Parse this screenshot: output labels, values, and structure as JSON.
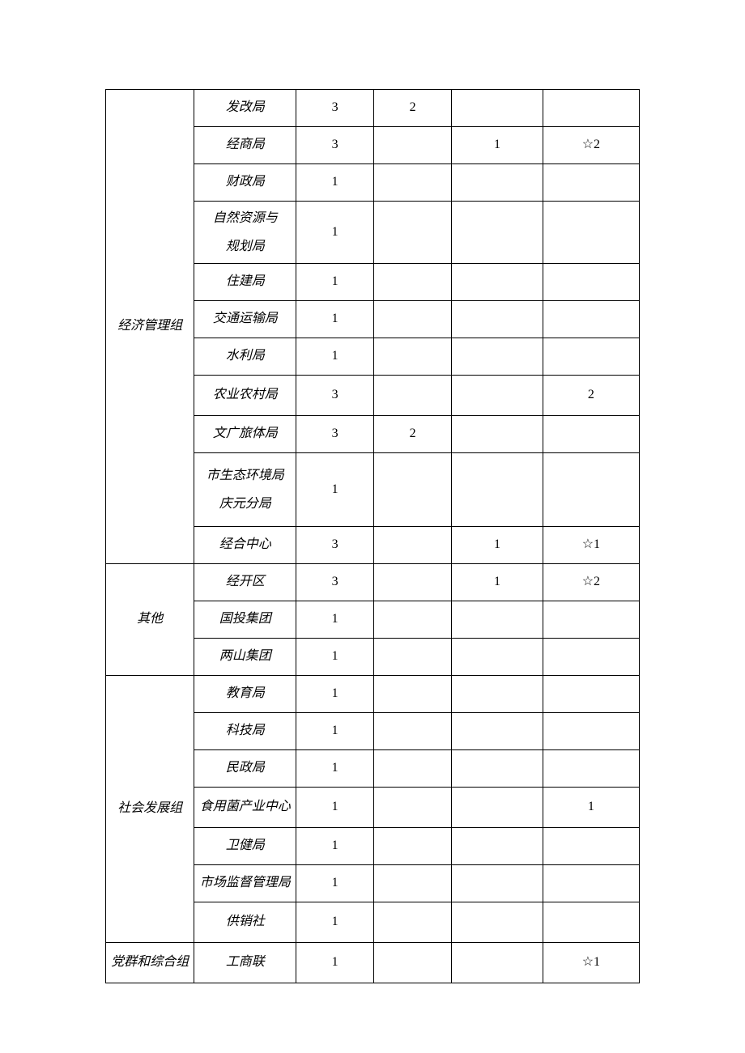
{
  "groups": {
    "g1": "经济管理组",
    "g2": "其他",
    "g3": "社会发展组",
    "g4": "党群和综合组"
  },
  "rows": {
    "r1": {
      "dept": "发改局",
      "c3": "3",
      "c4": "2",
      "c5": "",
      "c6": ""
    },
    "r2": {
      "dept": "经商局",
      "c3": "3",
      "c4": "",
      "c5": "1",
      "c6": "☆2"
    },
    "r3": {
      "dept": "财政局",
      "c3": "1",
      "c4": "",
      "c5": "",
      "c6": ""
    },
    "r4": {
      "dept": "自然资源与\n规划局",
      "c3": "1",
      "c4": "",
      "c5": "",
      "c6": ""
    },
    "r5": {
      "dept": "住建局",
      "c3": "1",
      "c4": "",
      "c5": "",
      "c6": ""
    },
    "r6": {
      "dept": "交通运输局",
      "c3": "1",
      "c4": "",
      "c5": "",
      "c6": ""
    },
    "r7": {
      "dept": "水利局",
      "c3": "1",
      "c4": "",
      "c5": "",
      "c6": ""
    },
    "r8": {
      "dept": "农业农村局",
      "c3": "3",
      "c4": "",
      "c5": "",
      "c6": "2"
    },
    "r9": {
      "dept": "文广旅体局",
      "c3": "3",
      "c4": "2",
      "c5": "",
      "c6": ""
    },
    "r10": {
      "dept": "市生态环境局\n庆元分局",
      "c3": "1",
      "c4": "",
      "c5": "",
      "c6": ""
    },
    "r11": {
      "dept": "经合中心",
      "c3": "3",
      "c4": "",
      "c5": "1",
      "c6": "☆1"
    },
    "r12": {
      "dept": "经开区",
      "c3": "3",
      "c4": "",
      "c5": "1",
      "c6": "☆2"
    },
    "r13": {
      "dept": "国投集团",
      "c3": "1",
      "c4": "",
      "c5": "",
      "c6": ""
    },
    "r14": {
      "dept": "两山集团",
      "c3": "1",
      "c4": "",
      "c5": "",
      "c6": ""
    },
    "r15": {
      "dept": "教育局",
      "c3": "1",
      "c4": "",
      "c5": "",
      "c6": ""
    },
    "r16": {
      "dept": "科技局",
      "c3": "1",
      "c4": "",
      "c5": "",
      "c6": ""
    },
    "r17": {
      "dept": "民政局",
      "c3": "1",
      "c4": "",
      "c5": "",
      "c6": ""
    },
    "r18": {
      "dept": "食用菌产业中心",
      "c3": "1",
      "c4": "",
      "c5": "",
      "c6": "1"
    },
    "r19": {
      "dept": "卫健局",
      "c3": "1",
      "c4": "",
      "c5": "",
      "c6": ""
    },
    "r20": {
      "dept": "市场监督管理局",
      "c3": "1",
      "c4": "",
      "c5": "",
      "c6": ""
    },
    "r21": {
      "dept": "供销社",
      "c3": "1",
      "c4": "",
      "c5": "",
      "c6": ""
    },
    "r22": {
      "dept": "工商联",
      "c3": "1",
      "c4": "",
      "c5": "",
      "c6": "☆1"
    }
  }
}
